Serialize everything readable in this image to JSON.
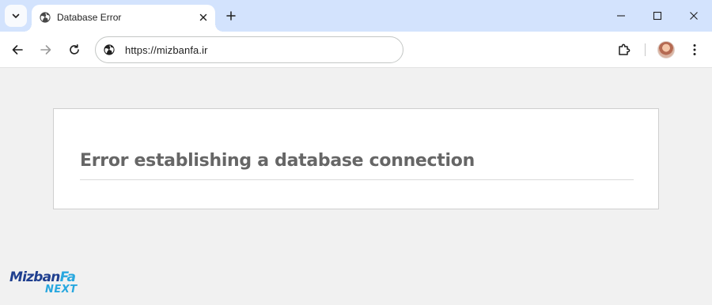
{
  "browser": {
    "tab": {
      "title": "Database Error",
      "favicon": "globe-icon"
    },
    "window_controls": [
      "minimize-icon",
      "maximize-icon",
      "close-icon"
    ],
    "toolbar": {
      "url": "https://mizbanfa.ir",
      "site_info_icon": "globe-icon",
      "buttons": [
        "back-arrow-icon",
        "forward-arrow-icon",
        "reload-icon",
        "extensions-puzzle-icon",
        "profile-avatar",
        "kebab-menu-icon"
      ]
    }
  },
  "page": {
    "error_heading": "Error establishing a database connection"
  },
  "watermark": {
    "brand_prefix": "Mizban",
    "brand_suffix": "Fa",
    "brand_tag": "NEXT"
  },
  "colors": {
    "tabstrip": "#d3e3fd",
    "page_background": "#f1f1f1",
    "heading_text": "#666666",
    "logo_primary": "#1f3f8f",
    "logo_accent": "#29a8df"
  }
}
